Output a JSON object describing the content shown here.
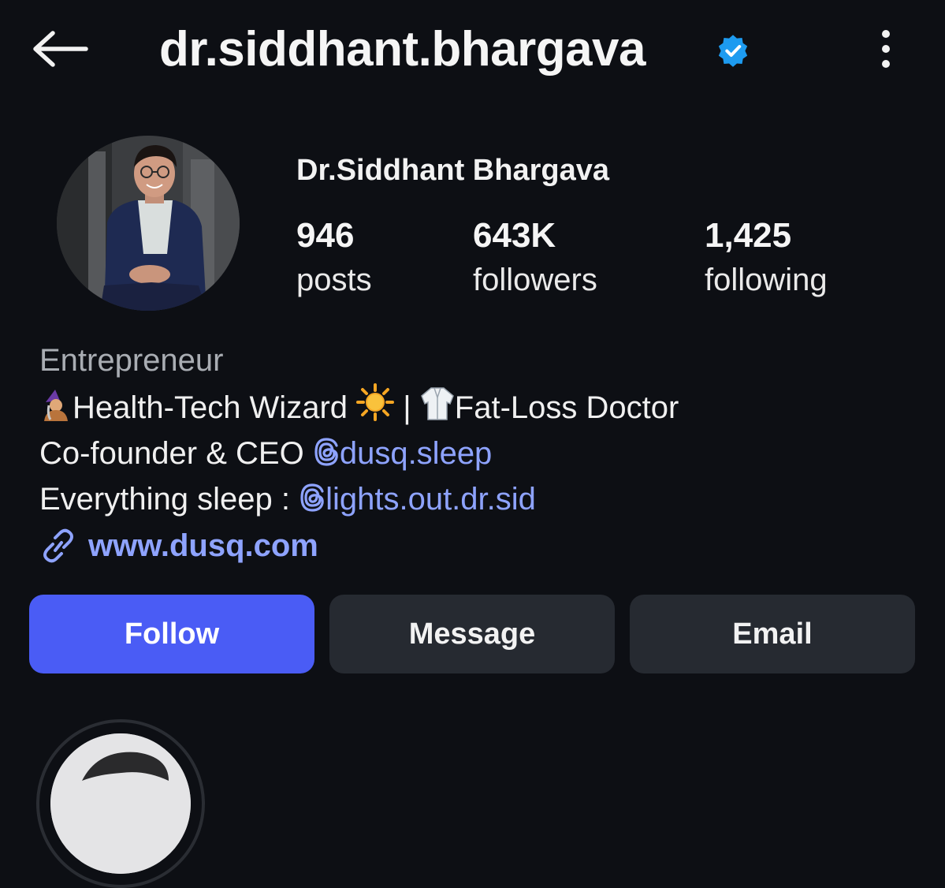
{
  "header": {
    "username": "dr.siddhant.bhargava",
    "verified": true,
    "back_icon": "arrow-left-icon",
    "more_icon": "vertical-dots-icon"
  },
  "profile": {
    "display_name": "Dr.Siddhant Bhargava",
    "stats": [
      {
        "value": "946",
        "label": "posts"
      },
      {
        "value": "643K",
        "label": "followers"
      },
      {
        "value": "1,425",
        "label": "following"
      }
    ]
  },
  "bio": {
    "category": "Entrepreneur",
    "line1_part1": "Health-Tech Wizard",
    "line1_sep": "|",
    "line1_part2": "Fat-Loss Doctor",
    "line2_prefix": "Co-founder & CEO",
    "line2_mention": "dusq.sleep",
    "line3_prefix": "Everything sleep :",
    "line3_mention": "lights.out.dr.sid",
    "website": "www.dusq.com"
  },
  "actions": {
    "follow": "Follow",
    "message": "Message",
    "email": "Email"
  },
  "colors": {
    "background": "#0d0f14",
    "accent": "#4a5cf5",
    "link": "#8ea3ff",
    "verified": "#1d9bf0",
    "secondary_button": "#262a31"
  }
}
